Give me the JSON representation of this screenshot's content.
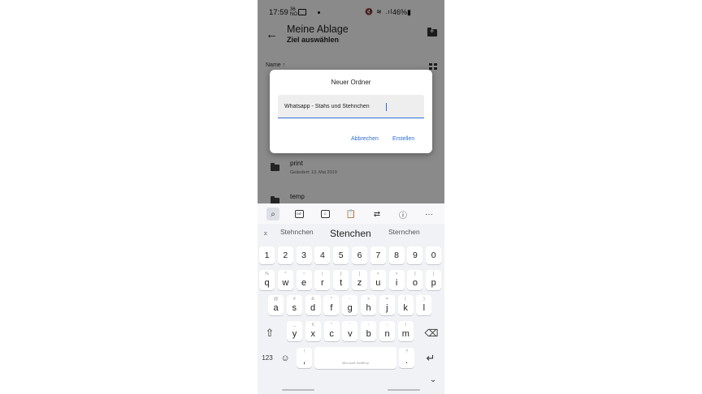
{
  "status_bar": {
    "time": "17:59",
    "time_extra_top": "36",
    "time_extra_bottom": "NO",
    "system_icons": "🔇 ≋ .ıl",
    "battery": "46%"
  },
  "toolbar": {
    "title": "Meine Ablage",
    "subtitle": "Ziel auswählen"
  },
  "list": {
    "sort_label": "Name ↑",
    "rows": [
      {
        "name": "print",
        "date": "Geändert: 13. Mai 2019"
      },
      {
        "name": "temp",
        "date": ""
      }
    ]
  },
  "dialog": {
    "title": "Neuer Ordner",
    "value": "Whatsapp - Stahs und Stehnchen",
    "cancel_label": "Abbrechen",
    "create_label": "Erstellen"
  },
  "keyboard": {
    "toolbar_icons": [
      "search-icon",
      "gif-icon",
      "sticker-icon",
      "clipboard-icon",
      "translate-icon",
      "info-icon",
      "more-icon"
    ],
    "suggestions": [
      "Stehnchen",
      "Stenchen",
      "Sternchen"
    ],
    "numbers": [
      "1",
      "2",
      "3",
      "4",
      "5",
      "6",
      "7",
      "8",
      "9",
      "0"
    ],
    "row1": [
      {
        "k": "q",
        "s": "%"
      },
      {
        "k": "w",
        "s": "^"
      },
      {
        "k": "e",
        "s": "~"
      },
      {
        "k": "r",
        "s": "|"
      },
      {
        "k": "t",
        "s": "["
      },
      {
        "k": "z",
        "s": "]"
      },
      {
        "k": "u",
        "s": "<"
      },
      {
        "k": "i",
        "s": ">"
      },
      {
        "k": "o",
        "s": "{"
      },
      {
        "k": "p",
        "s": "}"
      }
    ],
    "row2": [
      {
        "k": "a",
        "s": "@"
      },
      {
        "k": "s",
        "s": "#"
      },
      {
        "k": "d",
        "s": "&"
      },
      {
        "k": "f",
        "s": "*"
      },
      {
        "k": "g",
        "s": "-"
      },
      {
        "k": "h",
        "s": "+"
      },
      {
        "k": "j",
        "s": "="
      },
      {
        "k": "k",
        "s": "("
      },
      {
        "k": "l",
        "s": ")"
      }
    ],
    "row3": [
      {
        "k": "y",
        "s": "_"
      },
      {
        "k": "x",
        "s": "€"
      },
      {
        "k": "c",
        "s": "\""
      },
      {
        "k": "v",
        "s": "'"
      },
      {
        "k": "b",
        "s": ":"
      },
      {
        "k": "n",
        "s": ";"
      },
      {
        "k": "m",
        "s": "/"
      }
    ],
    "numbers_label": "123",
    "comma": ",",
    "comma_sec": "!",
    "period": ".",
    "period_sec": "?",
    "space_label": "Microsoft SwiftKey"
  },
  "colors": {
    "accent": "#2f6ed6",
    "scrim": "#000000",
    "keyboard_bg": "#f1f2f6"
  }
}
